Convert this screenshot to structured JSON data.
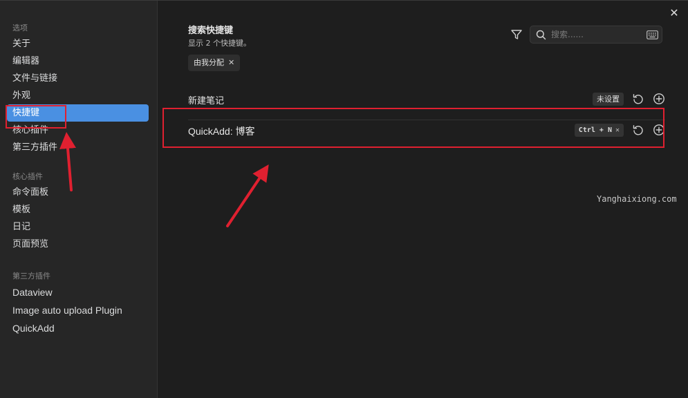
{
  "sidebar": {
    "section_options": "选项",
    "options_items": [
      {
        "label": "关于"
      },
      {
        "label": "编辑器"
      },
      {
        "label": "文件与链接"
      },
      {
        "label": "外观"
      },
      {
        "label": "快捷键",
        "active": true
      },
      {
        "label": "核心插件"
      },
      {
        "label": "第三方插件"
      }
    ],
    "section_core": "核心插件",
    "core_items": [
      {
        "label": "命令面板"
      },
      {
        "label": "模板"
      },
      {
        "label": "日记"
      },
      {
        "label": "页面预览"
      }
    ],
    "section_third": "第三方插件",
    "third_items": [
      {
        "label": "Dataview"
      },
      {
        "label": "Image auto upload Plugin"
      },
      {
        "label": "QuickAdd"
      }
    ]
  },
  "main": {
    "title": "搜索快捷键",
    "subtitle": "显示 2 个快捷键。",
    "search_placeholder": "搜索......",
    "filter_chip": "由我分配",
    "hotkeys": [
      {
        "name": "新建笔记",
        "hotkey": "未设置"
      },
      {
        "name": "QuickAdd: 博客",
        "hotkey": "Ctrl + N"
      }
    ]
  },
  "close_symbol": "✕",
  "chip_close": "✕",
  "hotkey_remove": "✕",
  "watermark": "Yanghaixiong.com",
  "accent_color": "#4a90e2",
  "annotation_color": "#e02030"
}
